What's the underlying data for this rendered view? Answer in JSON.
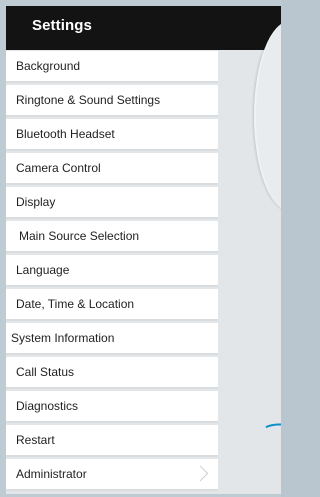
{
  "header": {
    "title": "Settings"
  },
  "menu": {
    "items": [
      {
        "label": "Background"
      },
      {
        "label": "Ringtone & Sound Settings"
      },
      {
        "label": "Bluetooth Headset"
      },
      {
        "label": "Camera Control"
      },
      {
        "label": "Display"
      },
      {
        "label": "Main Source Selection"
      },
      {
        "label": "Language"
      },
      {
        "label": "Date, Time & Location"
      },
      {
        "label": "System Information"
      },
      {
        "label": "Call Status"
      },
      {
        "label": "Diagnostics"
      },
      {
        "label": "Restart"
      },
      {
        "label": "Administrator"
      }
    ]
  },
  "icons": {
    "administrator_chevron": "chevron-right-icon"
  },
  "colors": {
    "header_bg": "#131313",
    "header_text": "#ffffff",
    "menu_bg": "#ffffff",
    "accent_arc": "#0f8fc7",
    "page_bg": "#e3e6e8"
  }
}
